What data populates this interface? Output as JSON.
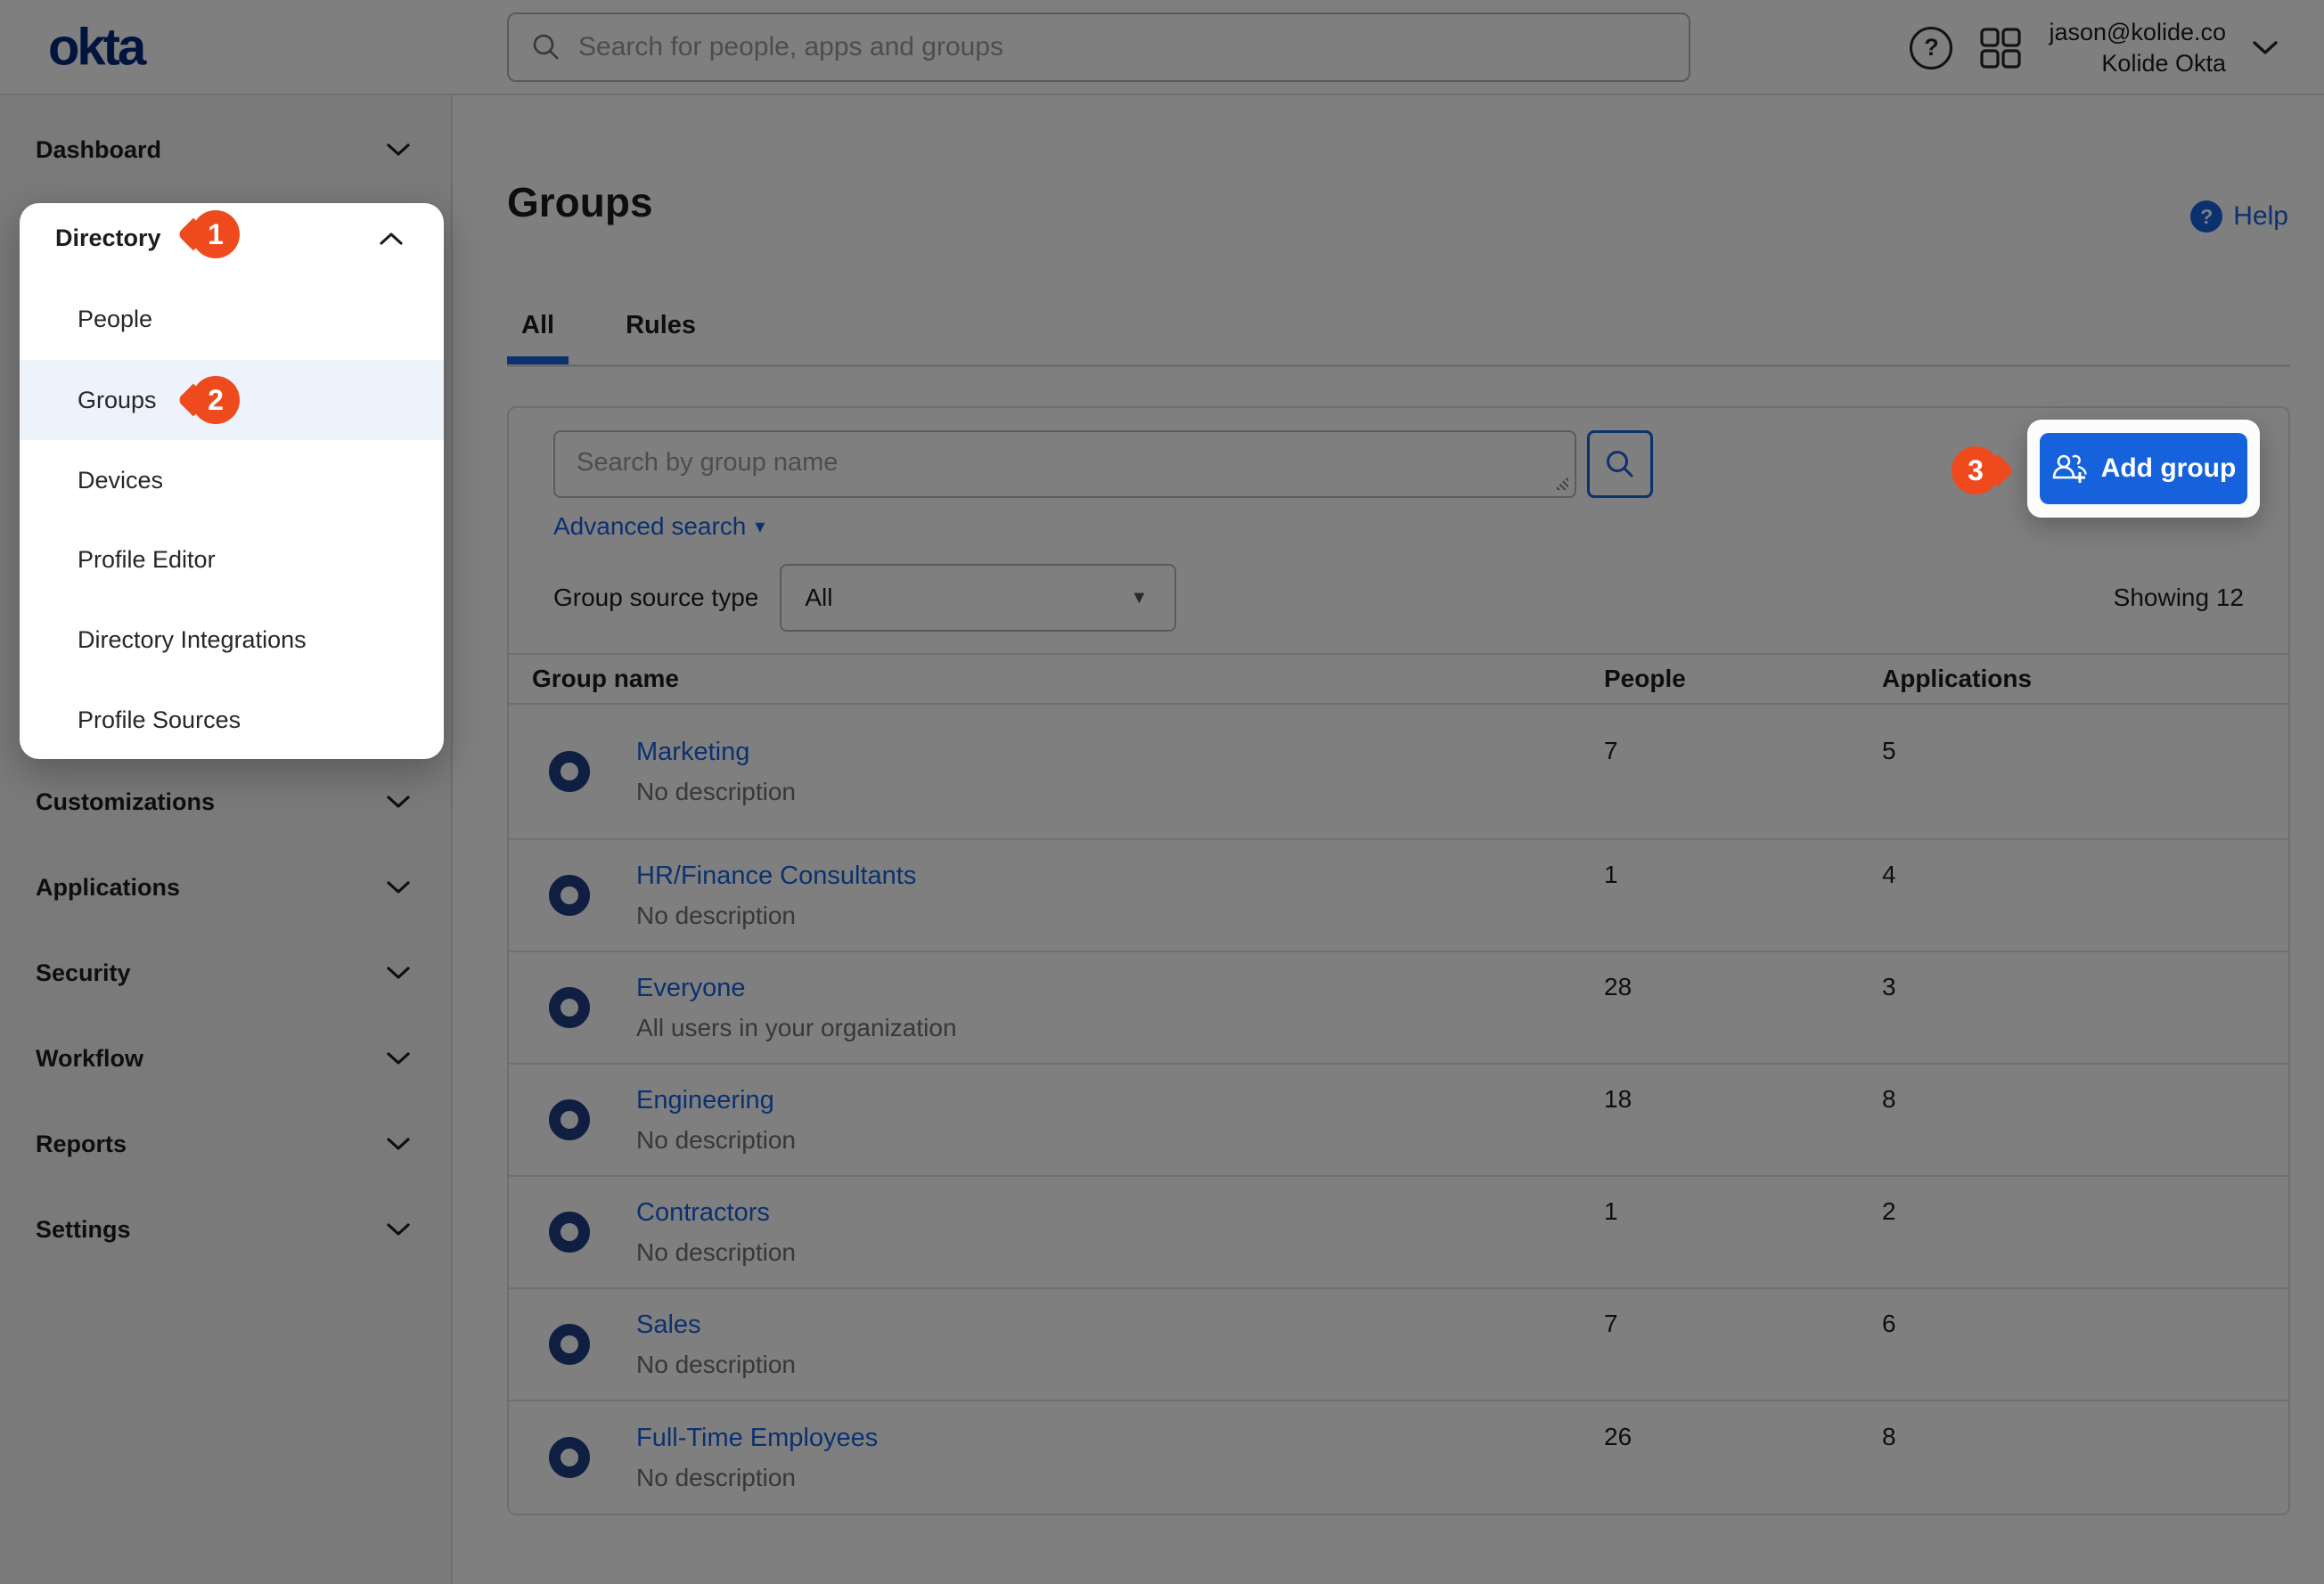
{
  "topbar": {
    "logo": "okta",
    "search_placeholder": "Search for people, apps and groups",
    "user_email": "jason@kolide.co",
    "user_org": "Kolide Okta"
  },
  "sidebar": {
    "dashboard": "Dashboard",
    "popover": {
      "header": "Directory",
      "items": [
        "People",
        "Groups",
        "Devices",
        "Profile Editor",
        "Directory Integrations",
        "Profile Sources"
      ]
    },
    "items": [
      "Customizations",
      "Applications",
      "Security",
      "Workflow",
      "Reports",
      "Settings"
    ]
  },
  "steps": {
    "step1": "1",
    "step2": "2",
    "step3": "3"
  },
  "page": {
    "title": "Groups",
    "help_label": "Help"
  },
  "tabs": {
    "all": "All",
    "rules": "Rules"
  },
  "toolbar": {
    "group_search_placeholder": "Search by group name",
    "advanced_search_label": "Advanced search",
    "add_group_label": "Add group"
  },
  "filter": {
    "label": "Group source type",
    "value": "All",
    "showing": "Showing 12"
  },
  "table": {
    "columns": [
      "Group name",
      "People",
      "Applications"
    ],
    "rows": [
      {
        "name": "Marketing",
        "description": "No description",
        "people": "7",
        "applications": "5"
      },
      {
        "name": "HR/Finance Consultants",
        "description": "No description",
        "people": "1",
        "applications": "4"
      },
      {
        "name": "Everyone",
        "description": "All users in your organization",
        "people": "28",
        "applications": "3"
      },
      {
        "name": "Engineering",
        "description": "No description",
        "people": "18",
        "applications": "8"
      },
      {
        "name": "Contractors",
        "description": "No description",
        "people": "1",
        "applications": "2"
      },
      {
        "name": "Sales",
        "description": "No description",
        "people": "7",
        "applications": "6"
      },
      {
        "name": "Full-Time Employees",
        "description": "No description",
        "people": "26",
        "applications": "8"
      }
    ]
  },
  "icons": {
    "question": "?",
    "caret_down": "▾",
    "select_caret": "▼"
  },
  "colors": {
    "accent_blue": "#1662dd",
    "badge_red": "#ee4a1d",
    "navy": "#00297a",
    "row_highlight": "#eef2fb"
  }
}
